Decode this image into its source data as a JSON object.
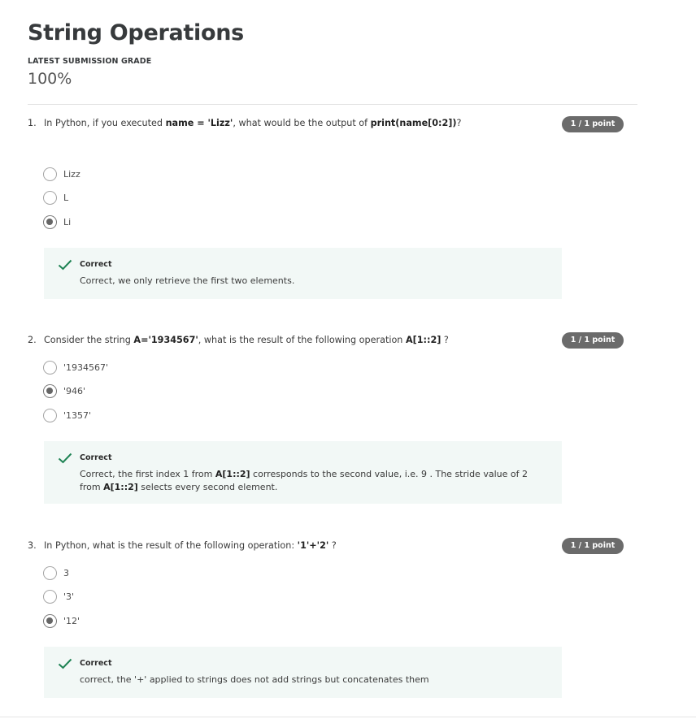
{
  "page": {
    "title": "String Operations",
    "grade_label": "LATEST SUBMISSION GRADE",
    "grade_value": "100%"
  },
  "questions": [
    {
      "number": "1.",
      "text_parts": [
        "In Python, if you executed ",
        "name = 'Lizz'",
        ", what would be the output of ",
        "print(name[0:2])",
        "?"
      ],
      "points": "1 / 1 point",
      "options": [
        {
          "label": "Lizz",
          "selected": false
        },
        {
          "label": "L",
          "selected": false
        },
        {
          "label": "Li",
          "selected": true
        }
      ],
      "feedback": {
        "title": "Correct",
        "text_parts": [
          "Correct, we only retrieve the first two elements."
        ]
      }
    },
    {
      "number": "2.",
      "text_parts": [
        "Consider the string ",
        "A='1934567'",
        ", what is the result of the following operation ",
        "A[1::2]",
        " ?"
      ],
      "points": "1 / 1 point",
      "options": [
        {
          "label": "'1934567'",
          "selected": false
        },
        {
          "label": "'946'",
          "selected": true
        },
        {
          "label": "'1357'",
          "selected": false
        }
      ],
      "feedback": {
        "title": "Correct",
        "text_parts": [
          "Correct, the first index 1 from ",
          "A[1::2]",
          " corresponds to the second value, i.e. 9 . The stride value of 2 from ",
          "A[1::2]",
          " selects every second element."
        ]
      }
    },
    {
      "number": "3.",
      "text_parts": [
        "In Python, what is the result of the following operation: ",
        "'1'+'2'",
        " ?"
      ],
      "points": "1 / 1 point",
      "options": [
        {
          "label": "3",
          "selected": false
        },
        {
          "label": "'3'",
          "selected": false
        },
        {
          "label": "'12'",
          "selected": true
        }
      ],
      "feedback": {
        "title": "Correct",
        "text_parts": [
          "correct, the '+' applied to strings does not add strings but concatenates them"
        ]
      }
    }
  ],
  "colors": {
    "badge": "#6b6b6b",
    "feedback_bg": "#f2f8f6",
    "check": "#1f8354"
  },
  "icons": {
    "correct": "check-icon",
    "radio_selected": "radio-selected",
    "radio_unselected": "radio-empty"
  }
}
